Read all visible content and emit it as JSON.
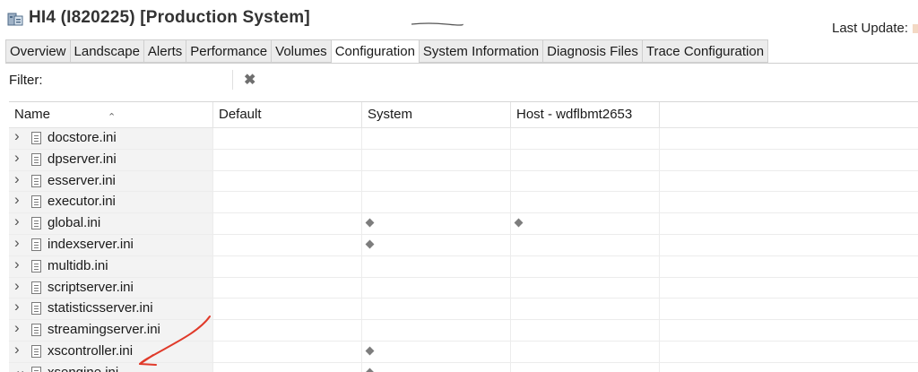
{
  "header": {
    "title": "HI4 (I820225) [Production System]",
    "last_update_label": "Last Update:"
  },
  "tabs": [
    {
      "label": "Overview"
    },
    {
      "label": "Landscape"
    },
    {
      "label": "Alerts"
    },
    {
      "label": "Performance"
    },
    {
      "label": "Volumes"
    },
    {
      "label": "Configuration",
      "active": true
    },
    {
      "label": "System Information"
    },
    {
      "label": "Diagnosis Files"
    },
    {
      "label": "Trace Configuration"
    }
  ],
  "filter": {
    "label": "Filter:",
    "value": ""
  },
  "table": {
    "columns": [
      "Name",
      "Default",
      "System",
      "Host - wdflbmt2653"
    ],
    "rows": [
      {
        "name": "docstore.ini",
        "expanded": false,
        "system": false,
        "host": false
      },
      {
        "name": "dpserver.ini",
        "expanded": false,
        "system": false,
        "host": false
      },
      {
        "name": "esserver.ini",
        "expanded": false,
        "system": false,
        "host": false
      },
      {
        "name": "executor.ini",
        "expanded": false,
        "system": false,
        "host": false
      },
      {
        "name": "global.ini",
        "expanded": false,
        "system": true,
        "host": true
      },
      {
        "name": "indexserver.ini",
        "expanded": false,
        "system": true,
        "host": false
      },
      {
        "name": "multidb.ini",
        "expanded": false,
        "system": false,
        "host": false
      },
      {
        "name": "scriptserver.ini",
        "expanded": false,
        "system": false,
        "host": false
      },
      {
        "name": "statisticsserver.ini",
        "expanded": false,
        "system": false,
        "host": false
      },
      {
        "name": "streamingserver.ini",
        "expanded": false,
        "system": false,
        "host": false
      },
      {
        "name": "xscontroller.ini",
        "expanded": false,
        "system": true,
        "host": false
      },
      {
        "name": "xsengine.ini",
        "expanded": true,
        "system": true,
        "host": false
      }
    ]
  },
  "annotation": {
    "color": "#e03a2a"
  }
}
